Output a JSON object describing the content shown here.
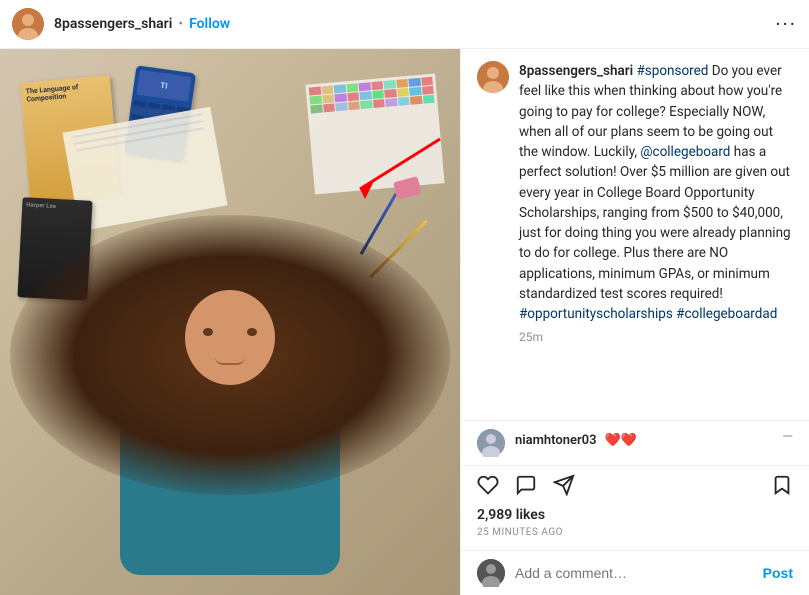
{
  "header": {
    "username": "8passengers_shari",
    "follow_label": "Follow",
    "more_label": "•••",
    "dot": "•"
  },
  "photo": {
    "alt": "Girl lying on floor surrounded by school books and supplies"
  },
  "main_comment": {
    "username": "8passengers_shari",
    "hashtag_sponsored": "#sponsored",
    "text": " Do you ever feel like this when thinking about how you're going to pay for college? Especially NOW, when all of our plans seem to be going out the window. Luckily, ",
    "mention_collegeboard": "@collegeboard",
    "text2": " has a perfect solution! Over $5 million are given out every year in College Board Opportunity Scholarships, ranging from $500 to $40,000, just for doing thing you were already planning to do for college. Plus there are NO applications, minimum GPAs, or minimum standardized test scores required! ",
    "hashtag1": "#opportunityscholarships",
    "hashtag2": "#collegeboardad",
    "time": "25m"
  },
  "reply_comment": {
    "username": "niamhtoner03",
    "hearts": "❤️❤️",
    "more": "—"
  },
  "actions": {
    "likes": "2,989 likes",
    "timestamp": "25 MINUTES AGO"
  },
  "add_comment": {
    "placeholder": "Add a comment…",
    "post_label": "Post"
  },
  "book1": {
    "title": "The Language of Composition"
  },
  "book2": {
    "title": "Harper Lee"
  }
}
